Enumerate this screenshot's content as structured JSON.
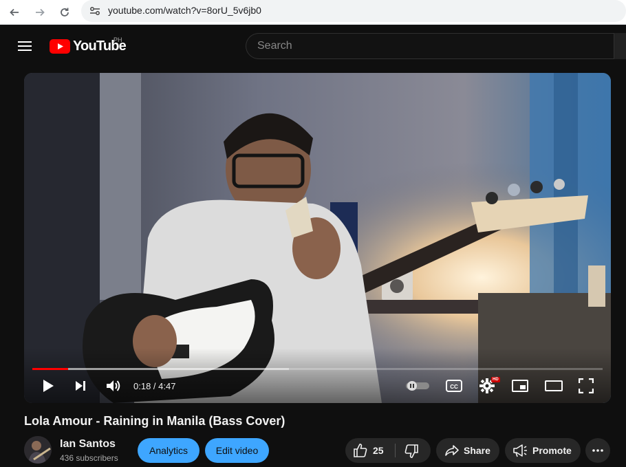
{
  "browser": {
    "url": "youtube.com/watch?v=8orU_5v6jb0"
  },
  "masthead": {
    "logo_text": "YouTube",
    "country_code": "PH",
    "search_placeholder": "Search"
  },
  "player": {
    "time_display": "0:18 / 4:47",
    "progress_fraction": 0.063,
    "buffered_fraction": 0.45,
    "hd_badge": "HD",
    "cc_label": "CC"
  },
  "video": {
    "title": "Lola Amour - Raining in Manila (Bass Cover)"
  },
  "channel": {
    "name": "Ian Santos",
    "subscribers": "436 subscribers"
  },
  "actions": {
    "analytics_label": "Analytics",
    "edit_video_label": "Edit video",
    "like_count": "25",
    "share_label": "Share",
    "promote_label": "Promote"
  },
  "colors": {
    "accent_blue": "#3ea6ff",
    "youtube_red": "#ff0000",
    "background": "#0f0f0f"
  }
}
